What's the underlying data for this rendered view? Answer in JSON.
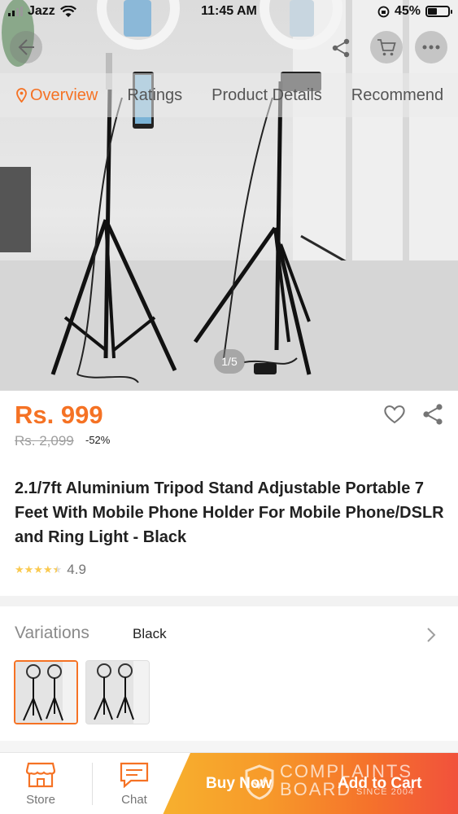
{
  "status_bar": {
    "carrier": "Jazz",
    "time": "11:45 AM",
    "battery": "45%"
  },
  "tabs": [
    {
      "label": "Overview"
    },
    {
      "label": "Ratings"
    },
    {
      "label": "Product Details"
    },
    {
      "label": "Recommend"
    }
  ],
  "gallery": {
    "counter": "1/5"
  },
  "product": {
    "price": "Rs. 999",
    "original_price": "Rs. 2,099",
    "discount": "-52%",
    "title": "2.1/7ft Aluminium Tripod Stand Adjustable Portable 7 Feet With Mobile Phone Holder For Mobile Phone/DSLR and Ring Light - Black",
    "rating": "4.9",
    "rating_stars": 4.5
  },
  "variations": {
    "label": "Variations",
    "selected": "Black"
  },
  "bottom_bar": {
    "store_label": "Store",
    "chat_label": "Chat",
    "buy_now_label": "Buy Now",
    "add_to_cart_label": "Add to Cart"
  },
  "watermark": {
    "line1": "COMPLAINTS",
    "line2": "BOARD",
    "line3": "SINCE 2004"
  },
  "colors": {
    "accent": "#f57224",
    "star": "#faca51"
  },
  "icons": [
    "back-arrow-icon",
    "share-icon",
    "cart-icon",
    "more-icon",
    "location-pin-icon",
    "heart-icon",
    "chevron-right-icon",
    "store-icon",
    "chat-icon"
  ]
}
